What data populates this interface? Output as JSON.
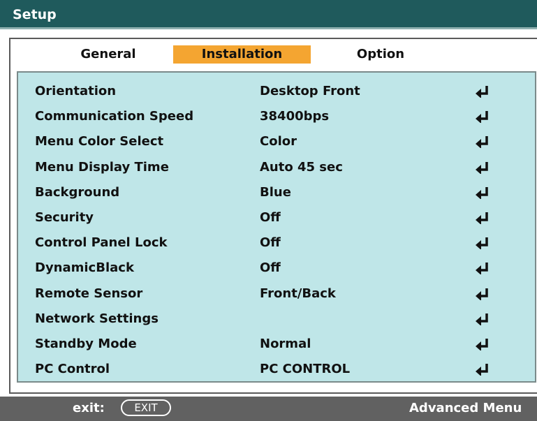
{
  "title": "Setup",
  "tabs": [
    {
      "label": "General",
      "active": false
    },
    {
      "label": "Installation",
      "active": true
    },
    {
      "label": "Option",
      "active": false
    }
  ],
  "rows": [
    {
      "label": "Orientation",
      "value": "Desktop Front"
    },
    {
      "label": "Communication Speed",
      "value": "38400bps"
    },
    {
      "label": "Menu Color Select",
      "value": "Color"
    },
    {
      "label": "Menu Display Time",
      "value": "Auto 45 sec"
    },
    {
      "label": "Background",
      "value": "Blue"
    },
    {
      "label": "Security",
      "value": "Off"
    },
    {
      "label": "Control Panel Lock",
      "value": "Off"
    },
    {
      "label": "DynamicBlack",
      "value": "Off"
    },
    {
      "label": "Remote Sensor",
      "value": "Front/Back"
    },
    {
      "label": "Network Settings",
      "value": ""
    },
    {
      "label": "Standby Mode",
      "value": "Normal"
    },
    {
      "label": "PC Control",
      "value": "PC CONTROL"
    }
  ],
  "footer": {
    "exit_label": "exit:",
    "exit_button": "EXIT",
    "advanced": "Advanced Menu"
  },
  "colors": {
    "title_bar": "#1f5a5c",
    "active_tab": "#f4a531",
    "panel": "#bfe6e8",
    "footer": "#616161"
  },
  "icons": {
    "row_action": "enter-return-icon"
  }
}
